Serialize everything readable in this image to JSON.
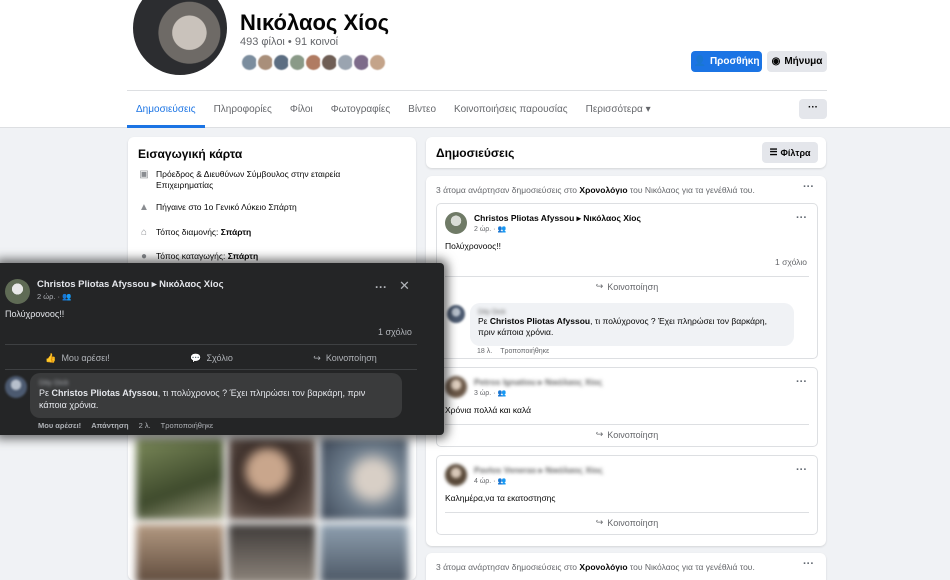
{
  "profile": {
    "name": "Νικόλαος Χίος",
    "friends": "493 φίλοι • 91 κοινοί",
    "add_button": "Προσθήκη",
    "message_button": "Μήνυμα",
    "friend_avatar_colors": [
      "#7b8d9e",
      "#a98f7a",
      "#5c6e82",
      "#8a9a88",
      "#b07b62",
      "#6f5e55",
      "#9aa4b0",
      "#7d6b8a",
      "#c4a48a"
    ]
  },
  "tabs": [
    "Δημοσιεύσεις",
    "Πληροφορίες",
    "Φίλοι",
    "Φωτογραφίες",
    "Βίντεο",
    "Κοινοποιήσεις παρουσίας",
    "Περισσότερα ▾"
  ],
  "tab_more": "···",
  "intro": {
    "title": "Εισαγωγική κάρτα",
    "work": "Πρόεδρος & Διευθύνων Σύμβουλος στην εταιρεία Επιχειρηματίας",
    "school": "Πήγαινε στο 1ο Γενικό Λύκειο Σπάρτη",
    "lives_prefix": "Τόπος διαμονής: ",
    "lives_city": "Σπάρτη",
    "from_prefix": "Τόπος καταγωγής: ",
    "from_city": "Σπάρτη"
  },
  "posts": {
    "title": "Δημοσιεύσεις",
    "filters": "Φίλτρα",
    "group_text_a": "3 άτομα ανάρτησαν δημοσιεύσεις στο ",
    "group_text_b": "Χρονολόγιο",
    "group_text_c": " του Νικόλαος για τα γενέθλιά του.",
    "share": "Κοινοποίηση",
    "post1": {
      "author": "Christos Pliotas Afyssou ▸ Νικόλαος Χίος",
      "time": "2 ώρ. · 👥",
      "body": "Πολύχρονοος!!",
      "comments_count": "1 σχόλιο",
      "comment_author": "Dity Dick",
      "comment_prefix": "Ρε ",
      "comment_mention": "Christos Pliotas Afyssou",
      "comment_rest": ", τι πολύχρονος ? Έχει πληρώσει τον βαρκάρη, πριν κάποια χρόνια.",
      "comment_time": "18 λ.",
      "comment_edited": "Τροποποιήθηκε"
    },
    "post2": {
      "author": "Petros Ignatiou ▸ Νικόλαος Χίος",
      "time": "3 ώρ. · 👥",
      "body": "Χρόνια πολλά και καλά"
    },
    "post3": {
      "author": "Pavlos Veneras ▸ Νικόλαος Χίος",
      "time": "4 ώρ. · 👥",
      "body": "Καλημέρα,να τα εκατοστησης"
    }
  },
  "overlay": {
    "author": "Christos Pliotas Afyssou ▸ Νικόλαος Χίος",
    "time": "2 ώρ. · 👥",
    "body": "Πολύχρονοος!!",
    "comments_count": "1 σχόλιο",
    "like": "Μου αρέσει!",
    "comment": "Σχόλιο",
    "share": "Κοινοποίηση",
    "comment_author": "Dity Dick",
    "comment_prefix": "Ρε ",
    "comment_mention": "Christos Pliotas Afyssou",
    "comment_rest": ", τι πολύχρονος ? Έχει πληρώσει τον βαρκάρη, πριν κάποια χρόνια.",
    "meta_like": "Μου αρέσει!",
    "meta_reply": "Απάντηση",
    "meta_time": "2 λ.",
    "meta_edited": "Τροποποιήθηκε"
  },
  "colors": {
    "accent": "#1b74e4",
    "dark_panel": "#242526"
  }
}
